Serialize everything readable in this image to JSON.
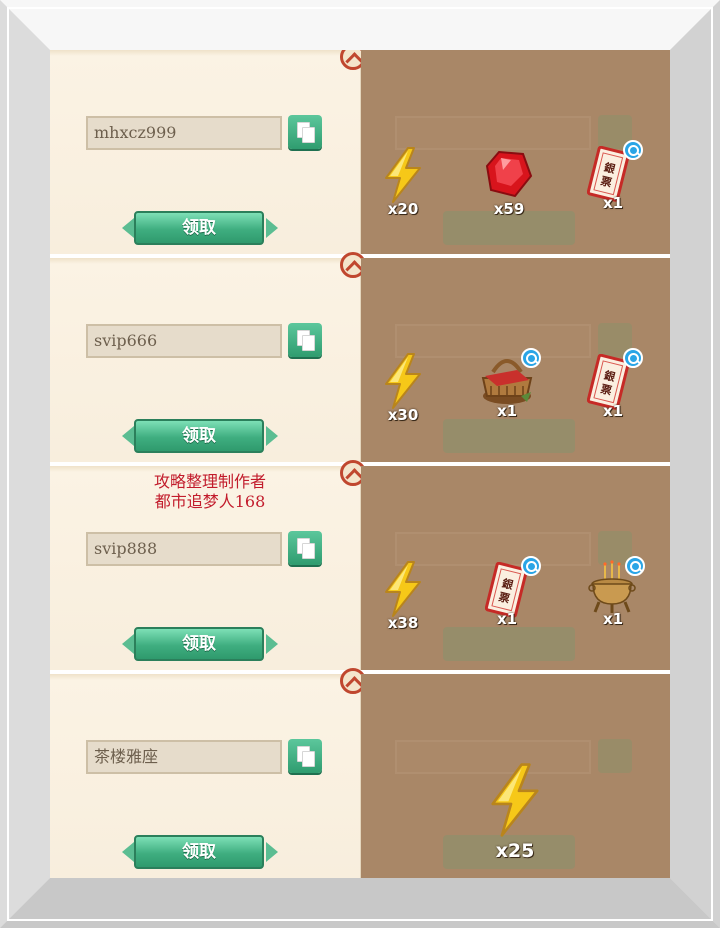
{
  "colors": {
    "accent_green": "#3fae80",
    "watermark_red": "#c21c2c",
    "overlay_brown": "#a98767",
    "panel_cream": "#fbf3e4"
  },
  "rows": [
    {
      "code": "mhxcz999",
      "claim_label": "领取",
      "rewards": [
        {
          "icon": "lightning-icon",
          "qty": "x20"
        },
        {
          "icon": "ruby-gem-icon",
          "qty": "x59"
        },
        {
          "icon": "silver-note-icon",
          "qty": "x1",
          "magnify": true
        }
      ]
    },
    {
      "code": "svip666",
      "claim_label": "领取",
      "rewards": [
        {
          "icon": "lightning-icon",
          "qty": "x30"
        },
        {
          "icon": "picnic-basket-icon",
          "qty": "x1",
          "magnify": true
        },
        {
          "icon": "silver-note-icon",
          "qty": "x1",
          "magnify": true
        }
      ]
    },
    {
      "code": "svip888",
      "claim_label": "领取",
      "watermark": [
        "攻略整理制作者",
        "都市追梦人168"
      ],
      "rewards": [
        {
          "icon": "lightning-icon",
          "qty": "x38"
        },
        {
          "icon": "silver-note-icon",
          "qty": "x1",
          "magnify": true
        },
        {
          "icon": "incense-burner-icon",
          "qty": "x1",
          "magnify": true
        }
      ]
    },
    {
      "code": "茶楼雅座",
      "claim_label": "领取",
      "rewards": [
        {
          "icon": "lightning-icon",
          "qty": "x25"
        }
      ]
    }
  ],
  "silver_note_text": "銀票"
}
